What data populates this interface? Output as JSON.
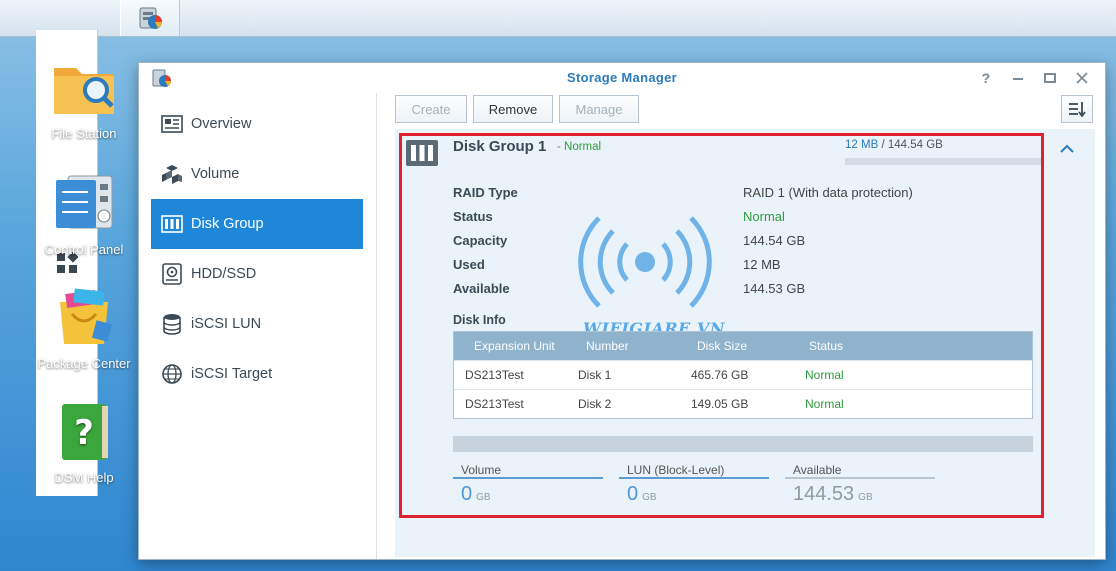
{
  "window": {
    "title": "Storage Manager"
  },
  "desktop": {
    "icons": [
      {
        "label": "File Station"
      },
      {
        "label": "Control Panel"
      },
      {
        "label": "Package Center"
      },
      {
        "label": "DSM Help"
      }
    ]
  },
  "sidebar": {
    "items": [
      {
        "label": "Overview",
        "icon": "overview-icon"
      },
      {
        "label": "Volume",
        "icon": "volume-icon"
      },
      {
        "label": "Disk Group",
        "icon": "disk-group-icon",
        "active": true
      },
      {
        "label": "HDD/SSD",
        "icon": "hdd-icon"
      },
      {
        "label": "iSCSI LUN",
        "icon": "iscsi-lun-icon"
      },
      {
        "label": "iSCSI Target",
        "icon": "globe-icon"
      }
    ]
  },
  "toolbar": {
    "create_label": "Create",
    "remove_label": "Remove",
    "manage_label": "Manage"
  },
  "disk_group": {
    "title": "Disk Group 1",
    "status_prefix": "- ",
    "status": "Normal",
    "used": "12 MB",
    "separator": " / ",
    "total": "144.54 GB",
    "usage_fraction": 0.0001,
    "properties": [
      {
        "key": "RAID Type",
        "value": "RAID 1 (With data protection)"
      },
      {
        "key": "Status",
        "value": "Normal",
        "ok": true
      },
      {
        "key": "Capacity",
        "value": "144.54 GB"
      },
      {
        "key": "Used",
        "value": "12 MB"
      },
      {
        "key": "Available",
        "value": "144.53 GB"
      }
    ],
    "disk_info_label": "Disk Info",
    "table": {
      "headers": [
        "Expansion Unit",
        "Number",
        "Disk Size",
        "Status"
      ],
      "rows": [
        [
          "DS213Test",
          "Disk 1",
          "465.76 GB",
          "Normal"
        ],
        [
          "DS213Test",
          "Disk 2",
          "149.05 GB",
          "Normal"
        ]
      ]
    },
    "stats": [
      {
        "label": "Volume",
        "value": "0",
        "unit": "GB"
      },
      {
        "label": "LUN (Block-Level)",
        "value": "0",
        "unit": "GB"
      },
      {
        "label": "Available",
        "value": "144.53",
        "unit": "GB"
      }
    ]
  },
  "watermark": {
    "text": "WIFIGIARE.VN"
  },
  "colors": {
    "accent": "#1e87d9",
    "title": "#2b7bbd",
    "ok": "#2e9b3c",
    "highlight_frame": "#e0212e"
  }
}
